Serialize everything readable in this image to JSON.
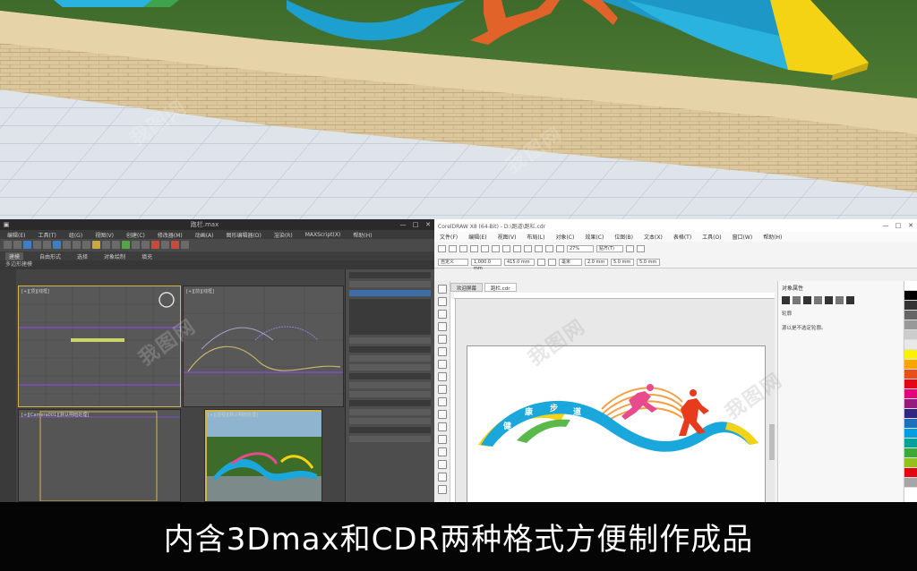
{
  "caption": {
    "text": "内含3Dmax和CDR两种格式方便制作成品"
  },
  "max_window": {
    "title": "跑栏.max",
    "menu": [
      "编辑(E)",
      "工具(T)",
      "组(G)",
      "视图(V)",
      "创建(C)",
      "修改器(M)",
      "动画(A)",
      "图形编辑器(D)",
      "渲染(R)",
      "MAXScript(X)",
      "帮助(H)"
    ],
    "ribbon_tabs": [
      "建模",
      "自由形式",
      "选择",
      "对象绘制",
      "填充"
    ],
    "sub_label": "多边形建模",
    "viewport_labels": [
      "[+][顶][线框]",
      "[+][前][线框]",
      "[+][Camera001][默认明暗处理]",
      "[+][透视][默认明暗处理]"
    ]
  },
  "cdr_window": {
    "title": "CorelDRAW X8 (64-Bit) - D:\\跑道\\跑栏.cdr",
    "menu": [
      "文件(F)",
      "编辑(E)",
      "视图(V)",
      "布局(L)",
      "对象(C)",
      "效果(C)",
      "位图(B)",
      "文本(X)",
      "表格(T)",
      "工具(O)",
      "窗口(W)",
      "帮助(H)"
    ],
    "zoom": "27%",
    "snap_label": "贴齐(T)",
    "size_w": "1,000.0 mm",
    "size_h": "415.0 mm",
    "unit": "毫米",
    "nudge": "2.0 mm",
    "spacing_x": "5.0 mm",
    "spacing_y": "5.0 mm",
    "preset": "自定义",
    "tabs": [
      "欢迎屏幕",
      "跑栏.cdr"
    ],
    "dock_title": "对象属性",
    "dock_sub": "轮廓",
    "dock_text": "源以是不选定轮廓。",
    "artwork_text": "健康步道",
    "colors": {
      "blue": "#1aa7dc",
      "yellow": "#f3d313",
      "green": "#5ab94a",
      "red": "#e83a1d",
      "pink": "#e84a8e",
      "orange": "#f2a043"
    }
  },
  "watermark": "我图网"
}
